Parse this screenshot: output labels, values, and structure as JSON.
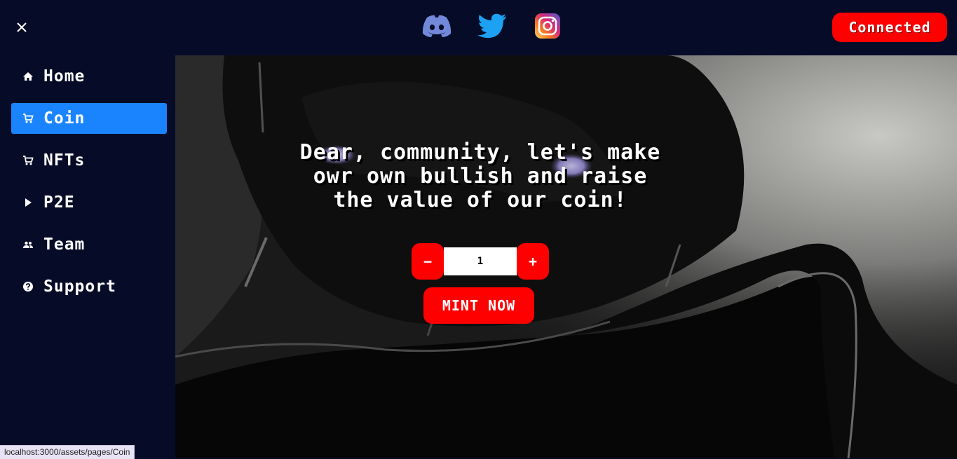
{
  "header": {
    "close_icon": "close-icon",
    "socials": [
      {
        "name": "discord",
        "icon": "discord-icon",
        "color": "#7289da"
      },
      {
        "name": "twitter",
        "icon": "twitter-icon",
        "color": "#1da1f2"
      },
      {
        "name": "instagram",
        "icon": "instagram-icon",
        "color": "#e1306c"
      }
    ],
    "connect_label": "Connected"
  },
  "sidebar": {
    "items": [
      {
        "label": "Home",
        "icon": "home-icon",
        "active": false
      },
      {
        "label": "Coin",
        "icon": "cart-icon",
        "active": true
      },
      {
        "label": "NFTs",
        "icon": "cart-icon",
        "active": false
      },
      {
        "label": "P2E",
        "icon": "play-icon",
        "active": false
      },
      {
        "label": "Team",
        "icon": "people-icon",
        "active": false
      },
      {
        "label": "Support",
        "icon": "help-icon",
        "active": false
      }
    ]
  },
  "hero": {
    "headline": "Dear, community, let's make owr own bullish and raise the value of our coin!",
    "minus_label": "−",
    "quantity": "1",
    "plus_label": "+",
    "mint_label": "MINT NOW"
  },
  "status_url": "localhost:3000/assets/pages/Coin",
  "colors": {
    "background": "#060c28",
    "accent": "#ff0000",
    "active_nav": "#1a84ff"
  }
}
